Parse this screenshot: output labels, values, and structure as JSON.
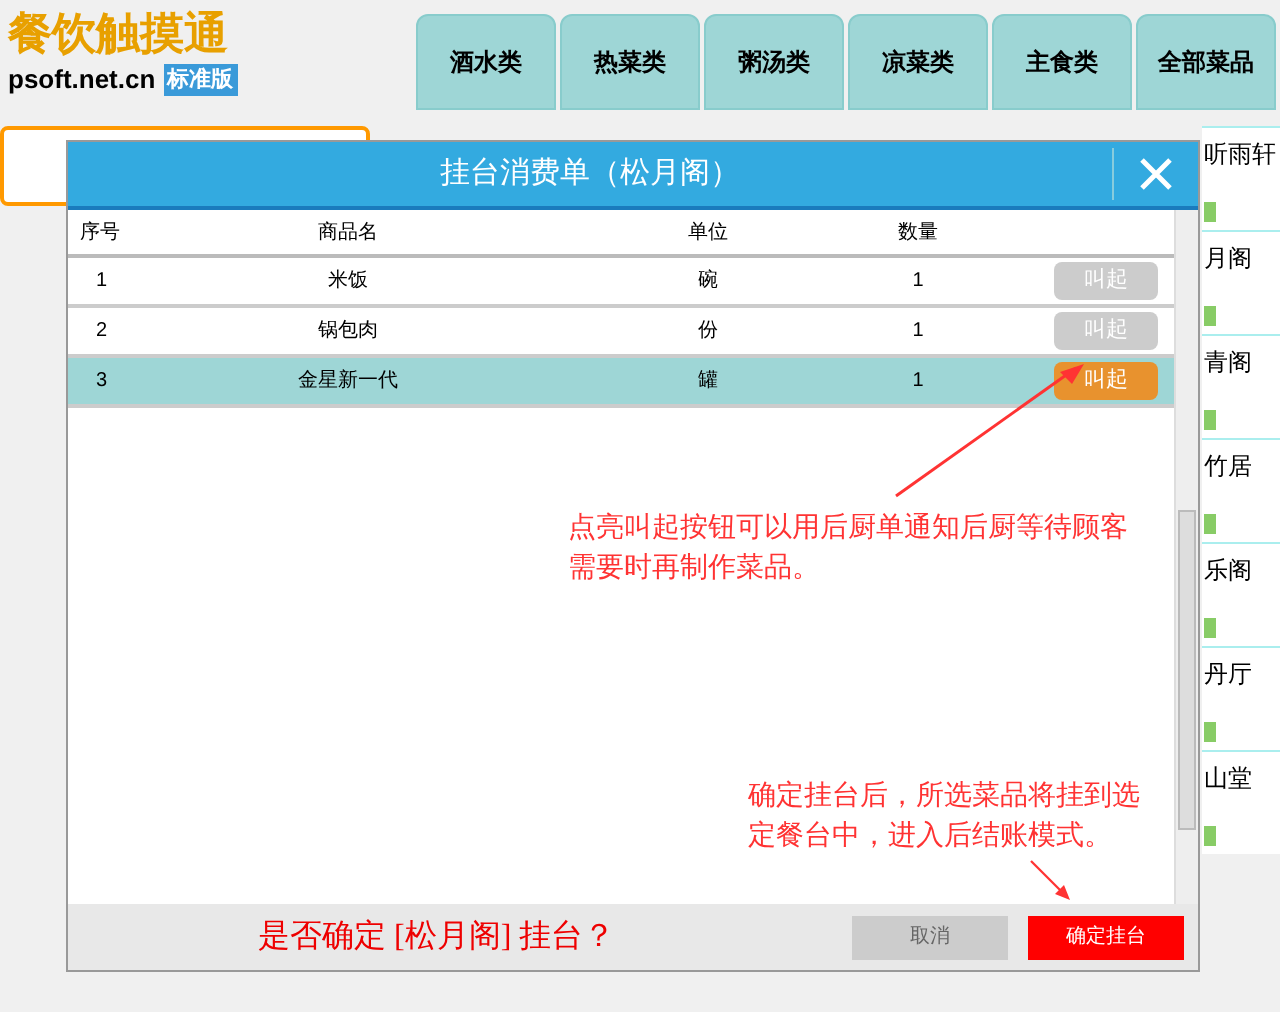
{
  "logo": {
    "title": "餐饮触摸通",
    "site": "psoft.net.cn",
    "edition": "标准版"
  },
  "tabs": [
    {
      "label": "酒水类",
      "selected": false
    },
    {
      "label": "热菜类",
      "selected": false
    },
    {
      "label": "粥汤类",
      "selected": false
    },
    {
      "label": "凉菜类",
      "selected": false
    },
    {
      "label": "主食类",
      "selected": false
    },
    {
      "label": "全部菜品",
      "selected": false
    }
  ],
  "side_tables": [
    "听雨轩",
    "月阁",
    "青阁",
    "竹居",
    "乐阁",
    "丹厅",
    "山堂"
  ],
  "dialog": {
    "title": "挂台消费单（松月阁）",
    "columns": [
      "序号",
      "商品名",
      "单位",
      "数量"
    ],
    "rows": [
      {
        "no": "1",
        "name": "米饭",
        "unit": "碗",
        "qty": "1",
        "action": "叫起",
        "selected": false,
        "on": false
      },
      {
        "no": "2",
        "name": "锅包肉",
        "unit": "份",
        "qty": "1",
        "action": "叫起",
        "selected": false,
        "on": false
      },
      {
        "no": "3",
        "name": "金星新一代",
        "unit": "罐",
        "qty": "1",
        "action": "叫起",
        "selected": true,
        "on": true
      }
    ],
    "note_1": "点亮叫起按钮可以用后厨单通知后厨等待顾客需要时再制作菜品。",
    "note_2": "确定挂台后，所选菜品将挂到选定餐台中，进入后结账模式。",
    "question": "是否确定 [松月阁] 挂台？",
    "cancel": "取消",
    "confirm": "确定挂台"
  }
}
